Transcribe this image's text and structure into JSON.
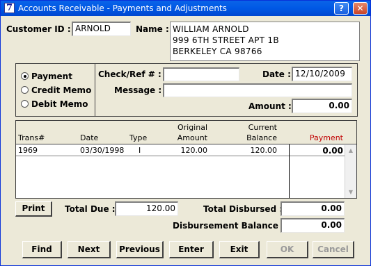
{
  "window": {
    "title": "Accounts Receivable - Payments and Adjustments",
    "app_icon_glyph": "7",
    "help_glyph": "?",
    "close_glyph": "✕"
  },
  "customer": {
    "id_label": "Customer ID :",
    "id_value": "ARNOLD",
    "name_label": "Name :",
    "name_line1": "WILLIAM ARNOLD",
    "address_line1": "999 6TH STREET APT 1B",
    "address_line2": "BERKELEY   CA  98766"
  },
  "payment_type": {
    "options": [
      "Payment",
      "Credit Memo",
      "Debit Memo"
    ],
    "selected": "Payment"
  },
  "entry": {
    "check_label": "Check/Ref # :",
    "check_value": "",
    "date_label": "Date :",
    "date_value": "12/10/2009",
    "message_label": "Message :",
    "message_value": "",
    "amount_label": "Amount :",
    "amount_value": "0.00"
  },
  "grid": {
    "headers": {
      "trans": "Trans#",
      "date": "Date",
      "type": "Type",
      "original_top": "Original",
      "original_bottom": "Amount",
      "current_top": "Current",
      "current_bottom": "Balance",
      "payment": "Payment"
    },
    "rows": [
      {
        "trans": "1969",
        "date": "03/30/1998",
        "type": "I",
        "original": "120.00",
        "balance": "120.00",
        "payment": "0.00"
      }
    ],
    "scroll_up": "▲",
    "scroll_down": "▼"
  },
  "totals": {
    "print_label": "Print",
    "total_due_label": "Total Due :",
    "total_due_value": "120.00",
    "total_disbursed_label": "Total Disbursed :",
    "total_disbursed_value": "0.00",
    "disbursement_balance_label": "Disbursement Balance :",
    "disbursement_balance_value": "0.00"
  },
  "buttons": {
    "find": "Find",
    "next": "Next",
    "previous": "Previous",
    "enter": "Enter",
    "exit": "Exit",
    "ok": "OK",
    "cancel": "Cancel"
  },
  "colors": {
    "titlebar": "#0058E5",
    "face": "#ECE9D8",
    "payment_header": "#C00000"
  }
}
